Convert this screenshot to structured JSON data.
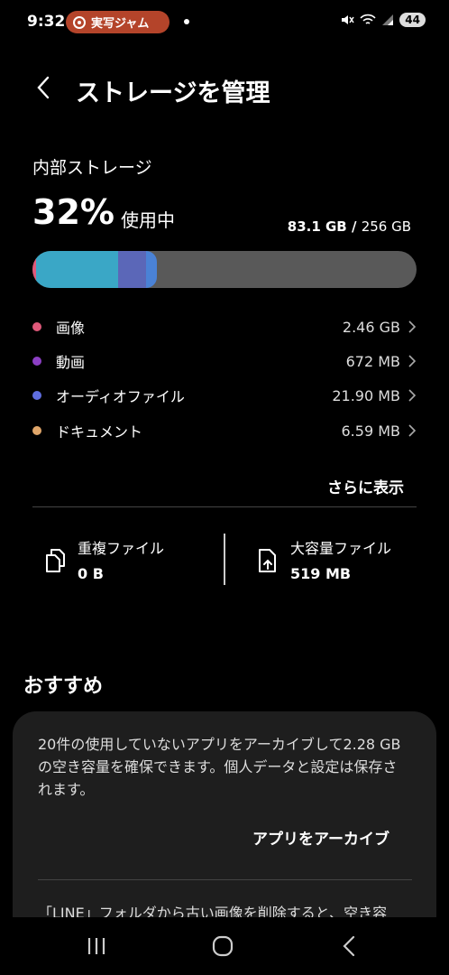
{
  "status_bar": {
    "time": "9:32",
    "recording_label": "実写ジャム",
    "battery": "44",
    "icons": [
      "mute-icon",
      "wifi-icon",
      "signal-icon",
      "battery-icon"
    ]
  },
  "header": {
    "title": "ストレージを管理",
    "back_icon": "chevron-left-icon"
  },
  "storage": {
    "section_label": "内部ストレージ",
    "percent_text": "32%",
    "percent_suffix": "使用中",
    "used_text": "83.1 GB",
    "separator": " / ",
    "total_text": "256 GB",
    "bar_segments": [
      {
        "fraction": 0.0096,
        "color": "#e0597a"
      },
      {
        "fraction": 0.2135,
        "color": "#3aa7c6"
      },
      {
        "fraction": 0.0727,
        "color": "#5b67b8"
      },
      {
        "fraction": 0.0282,
        "color": "#4a82d6"
      }
    ]
  },
  "categories": [
    {
      "label": "画像",
      "size": "2.46 GB",
      "color": "#e0597a"
    },
    {
      "label": "動画",
      "size": "672 MB",
      "color": "#8c3fc4"
    },
    {
      "label": "オーディオファイル",
      "size": "21.90 MB",
      "color": "#5f6ee0"
    },
    {
      "label": "ドキュメント",
      "size": "6.59 MB",
      "color": "#e0a66a"
    }
  ],
  "show_more": "さらに表示",
  "files": {
    "duplicate": {
      "title": "重複ファイル",
      "value": "0 B"
    },
    "large": {
      "title": "大容量ファイル",
      "value": "519 MB"
    }
  },
  "recommendations": {
    "title": "おすすめ",
    "card_text": "20件の使用していないアプリをアーカイブして2.28 GBの空き容量を確保できます。個人データと設定は保存されます。",
    "card_action": "アプリをアーカイブ",
    "card_text2": "「LINE」フォルダから古い画像を削除すると、空き容"
  },
  "colors": {
    "background": "#000000",
    "card": "#1e1e1e",
    "bar_track": "#595959",
    "recording_pill": "#b4442a"
  }
}
